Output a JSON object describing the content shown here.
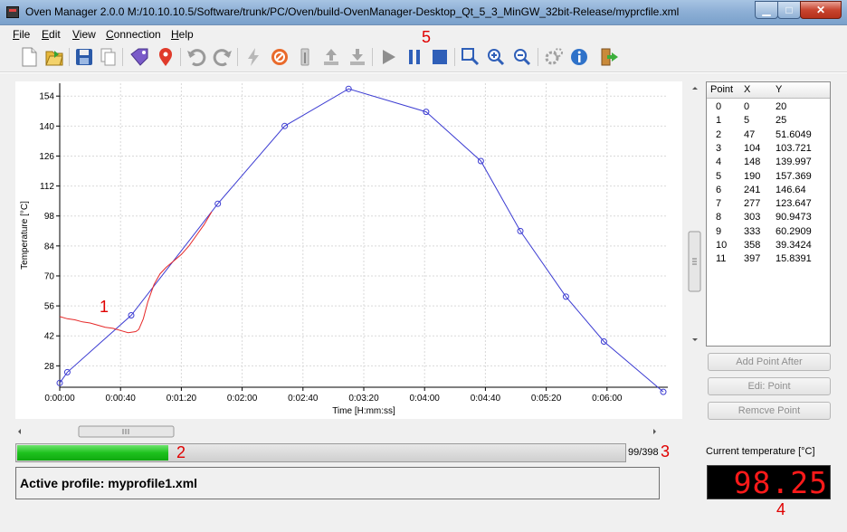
{
  "window": {
    "title": "Oven Manager 2.0.0 M:/10.10.10.5/Software/trunk/PC/Oven/build-OvenManager-Desktop_Qt_5_3_MinGW_32bit-Release/myprcfile.xml",
    "minimize": "▁",
    "maximize": "□",
    "close": "✕"
  },
  "menu": {
    "file": {
      "key": "F",
      "rest": "ile"
    },
    "edit": {
      "key": "E",
      "rest": "dit"
    },
    "view": {
      "key": "V",
      "rest": "iew"
    },
    "connection": {
      "key": "C",
      "rest": "onnection"
    },
    "help": {
      "key": "H",
      "rest": "elp"
    }
  },
  "toolbar": {
    "icons": [
      "new-file-icon",
      "open-folder-icon",
      "save-icon",
      "copy-icon",
      "tag-icon",
      "location-pin-icon",
      "undo-icon",
      "redo-icon",
      "lightning-icon",
      "stop-sign-icon",
      "thermometer-icon",
      "upload-icon",
      "download-icon",
      "play-icon",
      "pause-icon",
      "stop-icon",
      "zoom-fit-icon",
      "zoom-in-icon",
      "zoom-out-icon",
      "settings-icon",
      "info-icon",
      "exit-icon"
    ]
  },
  "chart_data": {
    "type": "line",
    "xlabel": "Time [H:mm:ss]",
    "ylabel": "Temperature [°C]",
    "xlim": [
      0,
      400
    ],
    "ylim": [
      18,
      160
    ],
    "x_ticks": [
      {
        "v": 0,
        "label": "0:00:00"
      },
      {
        "v": 40,
        "label": "0:00:40"
      },
      {
        "v": 80,
        "label": "0:01:20"
      },
      {
        "v": 120,
        "label": "0:02:00"
      },
      {
        "v": 160,
        "label": "0:02:40"
      },
      {
        "v": 200,
        "label": "0:03:20"
      },
      {
        "v": 240,
        "label": "0:04:00"
      },
      {
        "v": 280,
        "label": "0:04:40"
      },
      {
        "v": 320,
        "label": "0:05:20"
      },
      {
        "v": 360,
        "label": "0:06:00"
      }
    ],
    "y_ticks": [
      28,
      42,
      56,
      70,
      84,
      98,
      112,
      126,
      140,
      154
    ],
    "grid": true,
    "series": [
      {
        "color": "#3c3cd2",
        "x": [
          0,
          5,
          47,
          104,
          148,
          190,
          241,
          277,
          303,
          333,
          358,
          397
        ],
        "y": [
          20,
          25,
          51.6049,
          103.721,
          139.997,
          157.369,
          146.64,
          123.647,
          90.9473,
          60.2909,
          39.3424,
          15.8391
        ]
      },
      {
        "color": "#e62828",
        "x": [
          0,
          5,
          10,
          15,
          20,
          25,
          30,
          35,
          40,
          45,
          50,
          52,
          55,
          58,
          62,
          66,
          70,
          75,
          80,
          85,
          90,
          95,
          100
        ],
        "y": [
          51,
          50,
          49.5,
          48.5,
          48,
          47,
          46,
          45.5,
          44.5,
          43.5,
          44,
          45,
          50,
          58,
          66,
          71,
          74,
          77,
          80,
          84,
          89,
          94,
          100
        ]
      }
    ]
  },
  "table": {
    "headers": [
      "Point",
      "X",
      "Y"
    ],
    "rows": [
      [
        "0",
        "0",
        "20"
      ],
      [
        "1",
        "5",
        "25"
      ],
      [
        "2",
        "47",
        "51.6049"
      ],
      [
        "3",
        "104",
        "103.721"
      ],
      [
        "4",
        "148",
        "139.997"
      ],
      [
        "5",
        "190",
        "157.369"
      ],
      [
        "6",
        "241",
        "146.64"
      ],
      [
        "7",
        "277",
        "123.647"
      ],
      [
        "8",
        "303",
        "90.9473"
      ],
      [
        "9",
        "333",
        "60.2909"
      ],
      [
        "10",
        "358",
        "39.3424"
      ],
      [
        "11",
        "397",
        "15.8391"
      ]
    ]
  },
  "buttons": {
    "add_point_after": "Add Point After",
    "edit_point": "Edi: Point",
    "remove_point": "Remcve Point"
  },
  "progress": {
    "value": 99,
    "max": 398,
    "label": "99/398"
  },
  "active_profile": "Active profile: myprofile1.xml",
  "current_temperature": {
    "label": "Current temperature [°C]",
    "value": "98.25"
  },
  "annotations": {
    "a1": "1",
    "a2": "2",
    "a3": "3",
    "a4": "4",
    "a5": "5"
  },
  "colors": {
    "progress_green": "#1ec21e",
    "lcd_red": "#ff1a1a",
    "annotation_red": "#e00000"
  }
}
